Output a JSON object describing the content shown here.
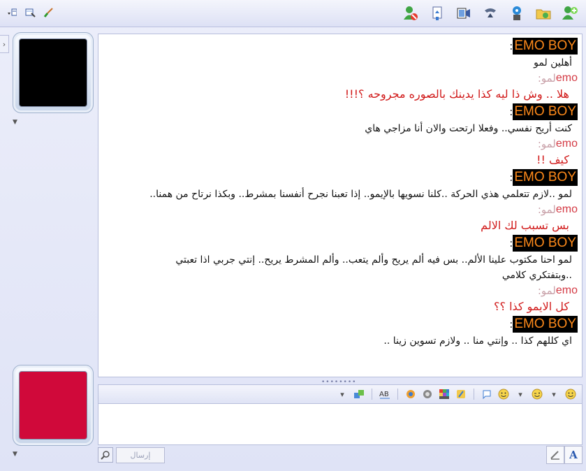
{
  "toolbar": {
    "left_icons": [
      "menu-dropdown-icon",
      "sharing-icon",
      "paint-brush-icon"
    ],
    "right_icons": [
      "block-contact-icon",
      "send-files-icon",
      "video-icon",
      "phone-icon",
      "games-icon",
      "activities-folder-icon",
      "add-contact-icon"
    ]
  },
  "conversation": {
    "messages": [
      {
        "sender": "EMO BOY",
        "type": "emoboy",
        "lines": [
          "أهلين لمو"
        ]
      },
      {
        "sender": "emo",
        "type": "emo",
        "prefix": "لمو:",
        "lines": [
          "هلا .. وش ذا ليه كذا يدينك بالصوره مجروحه ؟!!!"
        ]
      },
      {
        "sender": "EMO BOY",
        "type": "emoboy",
        "lines": [
          "كنت أريح نفسي.. وفعلا ارتحت والان أنا مزاجي هاي"
        ]
      },
      {
        "sender": "emo",
        "type": "emo",
        "prefix": "لمو:",
        "lines": [
          "كيف !!"
        ]
      },
      {
        "sender": "EMO BOY",
        "type": "emoboy",
        "lines": [
          "لمو ..لازم تتعلمي هذي الحركة ..كلنا نسويها بالإيمو.. إذا تعبنا نجرح أنفسنا بمشرط.. وبكذا نرتاح من همنا.."
        ]
      },
      {
        "sender": "emo",
        "type": "emo",
        "prefix": "لمو:",
        "lines": [
          "بس تسبب لك الالم"
        ]
      },
      {
        "sender": "EMO BOY",
        "type": "emoboy",
        "lines": [
          "لمو احنا مكتوب علينا الألم.. بس فيه ألم يريح وألم يتعب.. وألم المشرط يريح.. إنتي جربي اذا تعبتي",
          "..وبتفتكري كلامي"
        ]
      },
      {
        "sender": "emo",
        "type": "emo",
        "prefix": "لمو:",
        "lines": [
          "كل الايمو كذا ؟؟"
        ]
      },
      {
        "sender": "EMO BOY",
        "type": "emoboy",
        "lines": [
          "اي كللهم كذا .. وإنتي منا .. ولازم تسوين زينا .."
        ]
      }
    ]
  },
  "input": {
    "send_label": "إرسال",
    "text": ""
  },
  "colors": {
    "badge_bg": "#000000",
    "badge_fg": "#ff8a1a",
    "emo_red": "#d11a1a",
    "avatar_top": "#000000",
    "avatar_bottom": "#d0093a"
  }
}
